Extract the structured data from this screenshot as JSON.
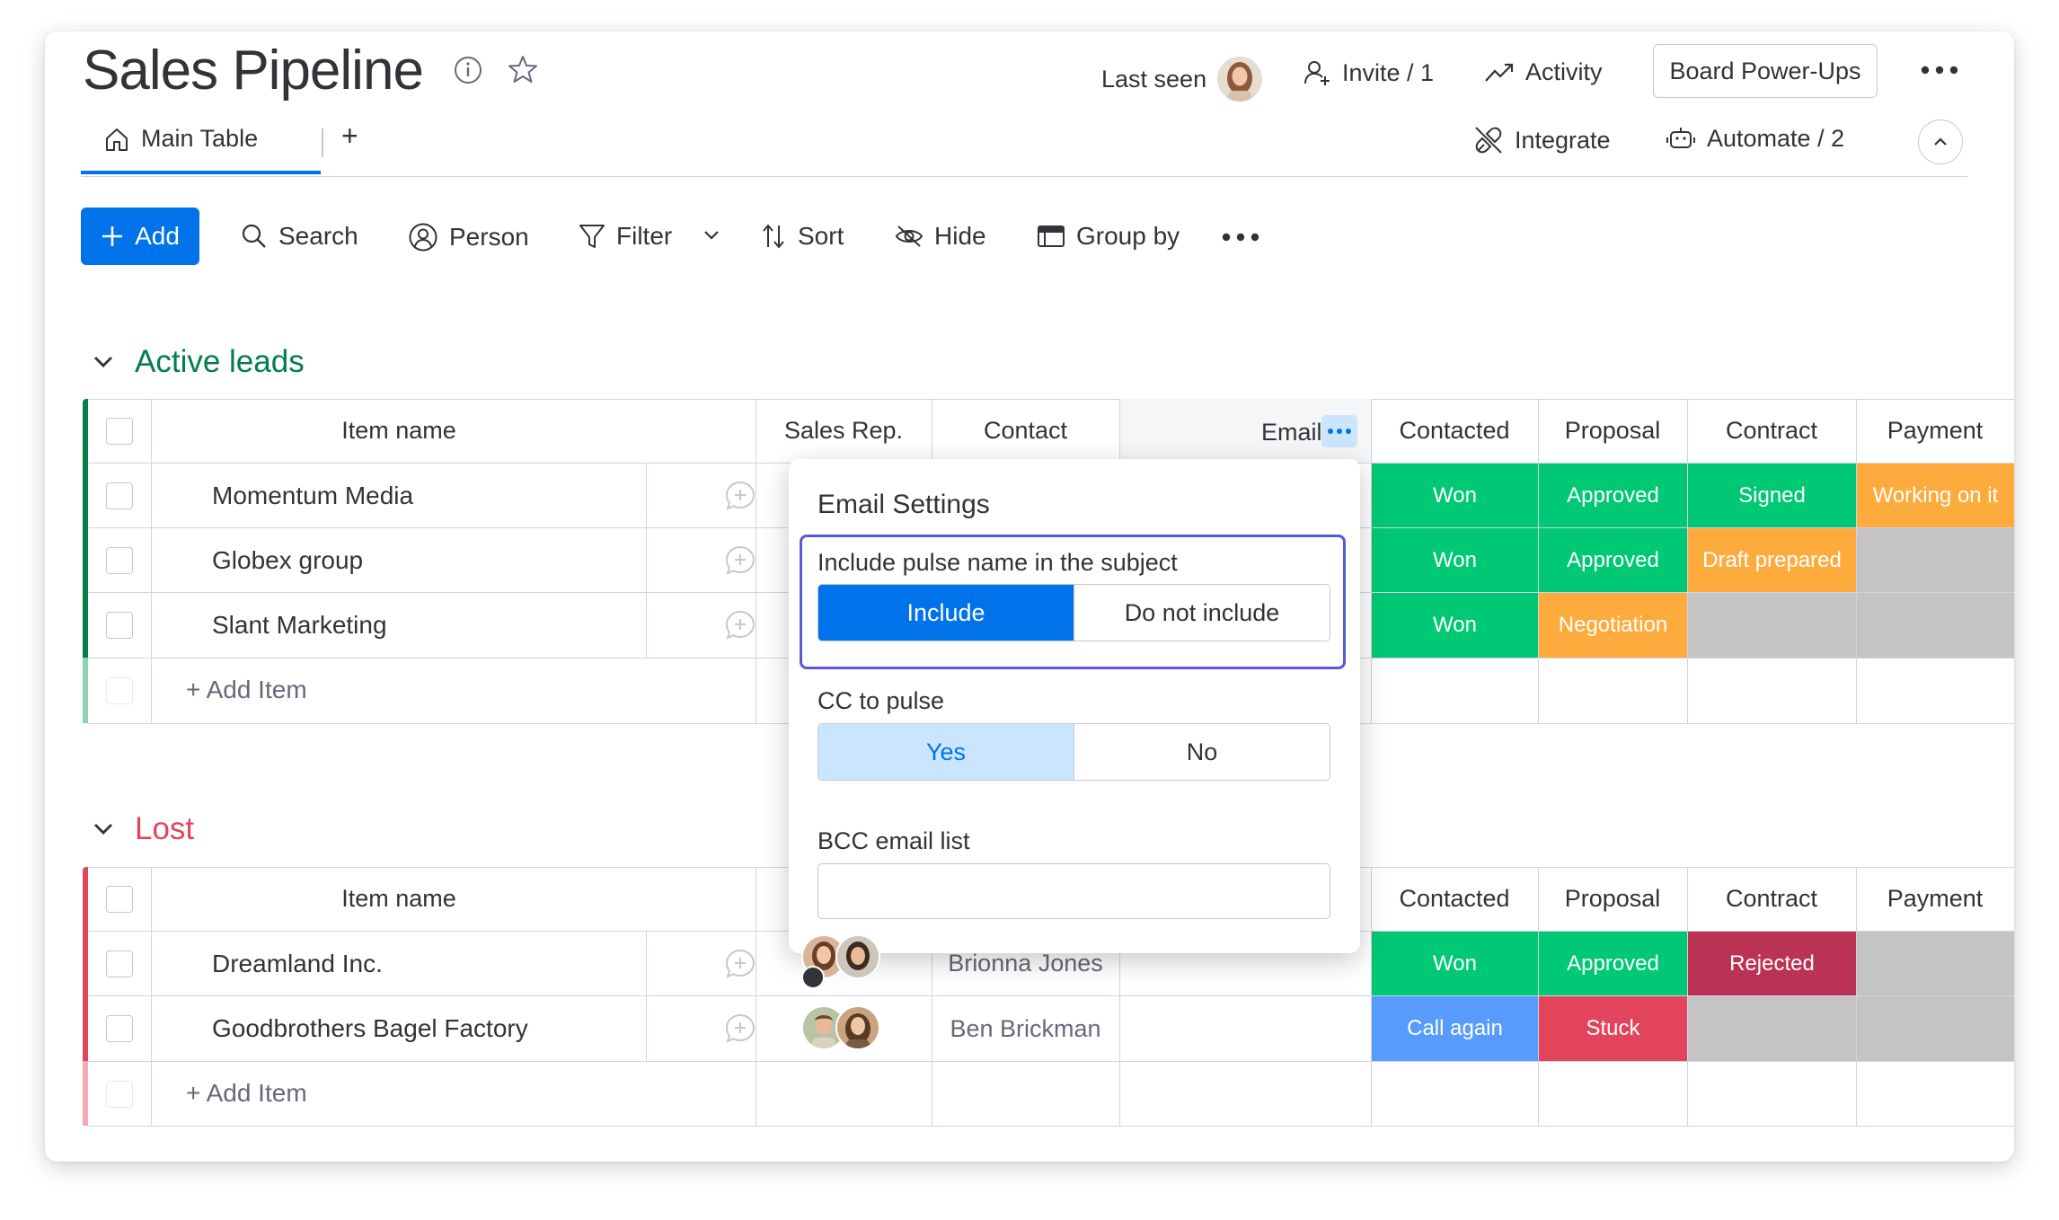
{
  "board": {
    "title": "Sales Pipeline",
    "last_seen_label": "Last seen",
    "invite_label": "Invite / 1",
    "activity_label": "Activity",
    "power_ups_label": "Board Power-Ups",
    "integrate_label": "Integrate",
    "automate_label": "Automate / 2",
    "tabs": [
      {
        "label": "Main Table"
      }
    ],
    "add_tab_label": "+"
  },
  "toolbar": {
    "add_label": "Add",
    "search_label": "Search",
    "person_label": "Person",
    "filter_label": "Filter",
    "sort_label": "Sort",
    "hide_label": "Hide",
    "group_by_label": "Group by"
  },
  "columns": [
    "Item name",
    "Sales Rep.",
    "Contact",
    "Email",
    "Contacted",
    "Proposal",
    "Contract",
    "Payment"
  ],
  "add_item_label": "+ Add Item",
  "groups": [
    {
      "title": "Active leads",
      "color": "#037f4c",
      "rows": [
        {
          "name": "Momentum Media",
          "contact": "",
          "contacted": "Won",
          "proposal": "Approved",
          "contract": "Signed",
          "payment": "Working on it"
        },
        {
          "name": "Globex group",
          "contact": "",
          "contacted": "Won",
          "proposal": "Approved",
          "contract": "Draft prepared",
          "payment": ""
        },
        {
          "name": "Slant Marketing",
          "contact": "",
          "contacted": "Won",
          "proposal": "Negotiation",
          "contract": "",
          "payment": ""
        }
      ]
    },
    {
      "title": "Lost",
      "color": "#e2445c",
      "rows": [
        {
          "name": "Dreamland Inc.",
          "contact": "Brionna Jones",
          "contacted": "Won",
          "proposal": "Approved",
          "contract": "Rejected",
          "payment": ""
        },
        {
          "name": "Goodbrothers Bagel Factory",
          "contact": "Ben Brickman",
          "contacted": "Call again",
          "proposal": "Stuck",
          "contract": "",
          "payment": ""
        }
      ]
    }
  ],
  "status_colors": {
    "Won": "#00c875",
    "Approved": "#00c875",
    "Signed": "#00c875",
    "Working on it": "#fdab3d",
    "Draft prepared": "#fdab3d",
    "Negotiation": "#fdab3d",
    "Rejected": "#bb3354",
    "Call again": "#579bfc",
    "Stuck": "#e2445c",
    "empty": "#c4c4c4"
  },
  "email_settings": {
    "title": "Email Settings",
    "include_label": "Include pulse name in the subject",
    "include_option": "Include",
    "not_include_option": "Do not include",
    "cc_label": "CC to pulse",
    "yes_option": "Yes",
    "no_option": "No",
    "bcc_label": "BCC email list",
    "bcc_value": ""
  },
  "icons": {
    "info": "info-icon",
    "star": "star-icon",
    "invite": "invite-person-icon",
    "activity": "activity-icon",
    "integrate": "integrate-icon",
    "automate": "robot-icon",
    "home": "home-icon",
    "search": "search-icon",
    "person": "person-icon",
    "filter": "filter-icon",
    "sort": "sort-icon",
    "hide": "eye-off-icon",
    "group_by": "group-by-icon",
    "more": "more-icon",
    "chevron": "chevron-down-icon",
    "add_update": "add-update-icon"
  }
}
